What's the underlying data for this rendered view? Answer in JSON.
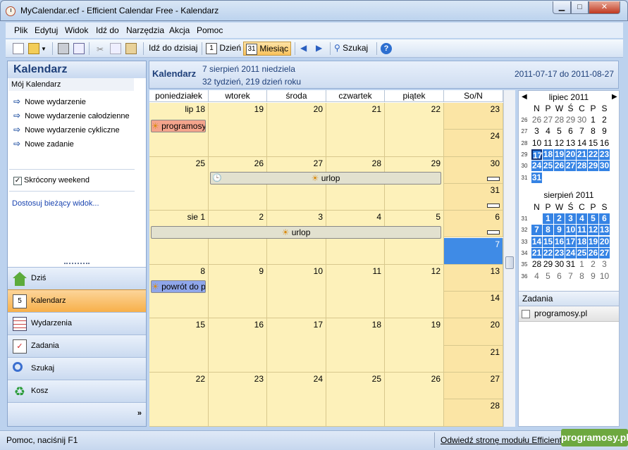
{
  "window": {
    "title": "MyCalendar.ecf - Efficient Calendar Free - Kalendarz",
    "minimize": "▁",
    "maximize": "□",
    "close": "✕"
  },
  "menu": [
    "Plik",
    "Edytuj",
    "Widok",
    "Idź do",
    "Narzędzia",
    "Akcja",
    "Pomoc"
  ],
  "toolbar": {
    "goto_today": "Idź do dzisiaj",
    "day": "Dzień",
    "month": "Miesiąc",
    "search": "Szukaj",
    "day_icon_text": "1",
    "month_icon_text": "31"
  },
  "left": {
    "header": "Kalendarz",
    "subheader": "Mój Kalendarz",
    "actions": [
      "Nowe wydarzenie",
      "Nowe wydarzenie całodzienne",
      "Nowe wydarzenie cykliczne",
      "Nowe zadanie"
    ],
    "short_weekend": "Skrócony weekend",
    "short_weekend_checked": true,
    "customize": "Dostosuj bieżący widok...",
    "nav": [
      "Dziś",
      "Kalendarz",
      "Wydarzenia",
      "Zadania",
      "Szukaj",
      "Kosz"
    ],
    "active_nav": "Kalendarz",
    "chevron": "»"
  },
  "main": {
    "title": "Kalendarz",
    "date_line": "7 sierpień 2011 niedziela",
    "week_line": "32 tydzień,  219 dzień roku",
    "range": "2011-07-17 do 2011-08-27",
    "day_headers": [
      "poniedziałek",
      "wtorek",
      "środa",
      "czwartek",
      "piątek",
      "So/N"
    ],
    "weeks": [
      {
        "days": [
          "lip 18",
          "19",
          "20",
          "21",
          "22"
        ],
        "sat": "23",
        "sun": "24"
      },
      {
        "days": [
          "25",
          "26",
          "27",
          "28",
          "29"
        ],
        "sat": "30",
        "sun": "31"
      },
      {
        "days": [
          "sie 1",
          "2",
          "3",
          "4",
          "5"
        ],
        "sat": "6",
        "sun": "7"
      },
      {
        "days": [
          "8",
          "9",
          "10",
          "11",
          "12"
        ],
        "sat": "13",
        "sun": "14"
      },
      {
        "days": [
          "15",
          "16",
          "17",
          "18",
          "19"
        ],
        "sat": "20",
        "sun": "21"
      },
      {
        "days": [
          "22",
          "23",
          "24",
          "25",
          "26"
        ],
        "sat": "27",
        "sun": "28"
      }
    ],
    "events": {
      "e1": "programosy.pl",
      "e2": "urlop",
      "e3": "urlop",
      "e4": "powrót do pracy"
    }
  },
  "minical": {
    "july": {
      "title": "lipiec 2011",
      "prev": "◀",
      "next": "▶"
    },
    "august": {
      "title": "sierpień 2011"
    },
    "dow": [
      "N",
      "P",
      "W",
      "Ś",
      "C",
      "P",
      "S"
    ],
    "july_weeks": [
      "26",
      "27",
      "28",
      "29",
      "30",
      "31"
    ],
    "july_rows": [
      [
        "26",
        "27",
        "28",
        "29",
        "30",
        "1",
        "2"
      ],
      [
        "3",
        "4",
        "5",
        "6",
        "7",
        "8",
        "9"
      ],
      [
        "10",
        "11",
        "12",
        "13",
        "14",
        "15",
        "16"
      ],
      [
        "17",
        "18",
        "19",
        "20",
        "21",
        "22",
        "23"
      ],
      [
        "24",
        "25",
        "26",
        "27",
        "28",
        "29",
        "30"
      ],
      [
        "31",
        "",
        "",
        "",
        "",
        "",
        ""
      ]
    ],
    "aug_weeks": [
      "31",
      "32",
      "33",
      "34",
      "35",
      "36"
    ],
    "aug_rows": [
      [
        "",
        "1",
        "2",
        "3",
        "4",
        "5",
        "6"
      ],
      [
        "7",
        "8",
        "9",
        "10",
        "11",
        "12",
        "13"
      ],
      [
        "14",
        "15",
        "16",
        "17",
        "18",
        "19",
        "20"
      ],
      [
        "21",
        "22",
        "23",
        "24",
        "25",
        "26",
        "27"
      ],
      [
        "28",
        "29",
        "30",
        "31",
        "1",
        "2",
        "3"
      ],
      [
        "4",
        "5",
        "6",
        "7",
        "8",
        "9",
        "10"
      ]
    ]
  },
  "tasks": {
    "header": "Zadania",
    "items": [
      "programosy.pl"
    ]
  },
  "status": {
    "left": "Pomoc, naciśnij F1",
    "link": "Odwiedź stronę modułu Efficient",
    "watermark": "programosy.pl"
  },
  "colors": {
    "weekday": "#fdf1ba",
    "weekend": "#fbe5a5",
    "selected": "#3f8be6",
    "ev1": "#f4a48c",
    "ev2": "#e2e1cf",
    "ev4": "#8fa6ea"
  }
}
